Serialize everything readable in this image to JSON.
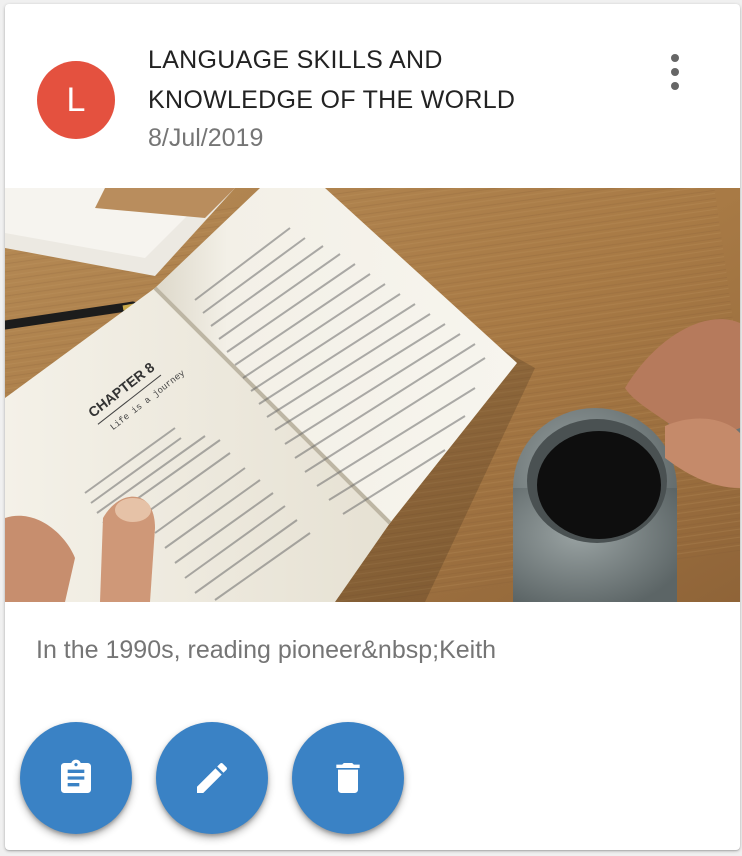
{
  "card": {
    "avatar_letter": "L",
    "title_line1": "LANGUAGE SKILLS AND",
    "title_line2": "KNOWLEDGE OF THE WORLD",
    "date": "8/Jul/2019",
    "excerpt": "In the 1990s, reading pioneer&nbsp;Keith",
    "media": {
      "chapter_heading": "CHAPTER 8",
      "chapter_subtitle": "Life is a journey"
    }
  },
  "actions": [
    {
      "name": "clipboard-icon"
    },
    {
      "name": "edit-icon"
    },
    {
      "name": "delete-icon"
    }
  ],
  "colors": {
    "avatar": "#e4513f",
    "fab": "#3a82c5"
  }
}
